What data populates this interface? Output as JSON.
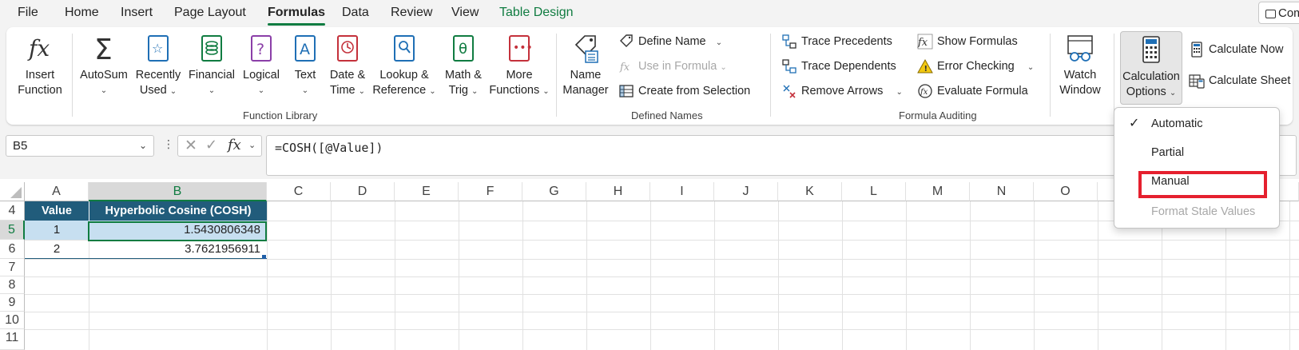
{
  "menu": {
    "tabs": [
      "File",
      "Home",
      "Insert",
      "Page Layout",
      "Formulas",
      "Data",
      "Review",
      "View",
      "Table Design"
    ],
    "active": "Formulas",
    "comments_label": "Com"
  },
  "ribbon": {
    "function_library": {
      "insert_function": [
        "Insert",
        "Function"
      ],
      "autosum": "AutoSum",
      "recently_used": [
        "Recently",
        "Used"
      ],
      "financial": "Financial",
      "logical": "Logical",
      "text": "Text",
      "date_time": [
        "Date &",
        "Time"
      ],
      "lookup_reference": [
        "Lookup &",
        "Reference"
      ],
      "math_trig": [
        "Math &",
        "Trig"
      ],
      "more_functions": [
        "More",
        "Functions"
      ],
      "group_label": "Function Library"
    },
    "defined_names": {
      "name_manager": [
        "Name",
        "Manager"
      ],
      "define_name": "Define Name",
      "use_in_formula": "Use in Formula",
      "create_from_selection": "Create from Selection",
      "group_label": "Defined Names"
    },
    "formula_auditing": {
      "trace_precedents": "Trace Precedents",
      "trace_dependents": "Trace Dependents",
      "remove_arrows": "Remove Arrows",
      "show_formulas": "Show Formulas",
      "error_checking": "Error Checking",
      "evaluate_formula": "Evaluate Formula",
      "group_label": "Formula Auditing"
    },
    "watch_window": [
      "Watch",
      "Window"
    ],
    "calculation": {
      "calculation_options": [
        "Calculation",
        "Options"
      ],
      "calculate_now": "Calculate Now",
      "calculate_sheet": "Calculate Sheet"
    }
  },
  "formula_bar": {
    "name_box": "B5",
    "formula": "=COSH([@Value])"
  },
  "sheet": {
    "columns": [
      "A",
      "B",
      "C",
      "D",
      "E",
      "F",
      "G",
      "H",
      "I",
      "J",
      "K",
      "L",
      "M",
      "N",
      "O"
    ],
    "rows": [
      "4",
      "5",
      "6",
      "7",
      "8",
      "9",
      "10",
      "11"
    ],
    "table": {
      "headers": [
        "Value",
        "Hyperbolic Cosine (COSH)"
      ],
      "rows": [
        [
          "1",
          "1.5430806348"
        ],
        [
          "2",
          "3.7621956911"
        ]
      ]
    }
  },
  "calc_menu": {
    "items": [
      "Automatic",
      "Partial",
      "Manual",
      "Format Stale Values"
    ],
    "checked": "Automatic"
  },
  "colors": {
    "accent_green": "#107c41",
    "table_header": "#215c7b",
    "table_band": "#ddebf7",
    "highlight_red": "#e5202e"
  }
}
